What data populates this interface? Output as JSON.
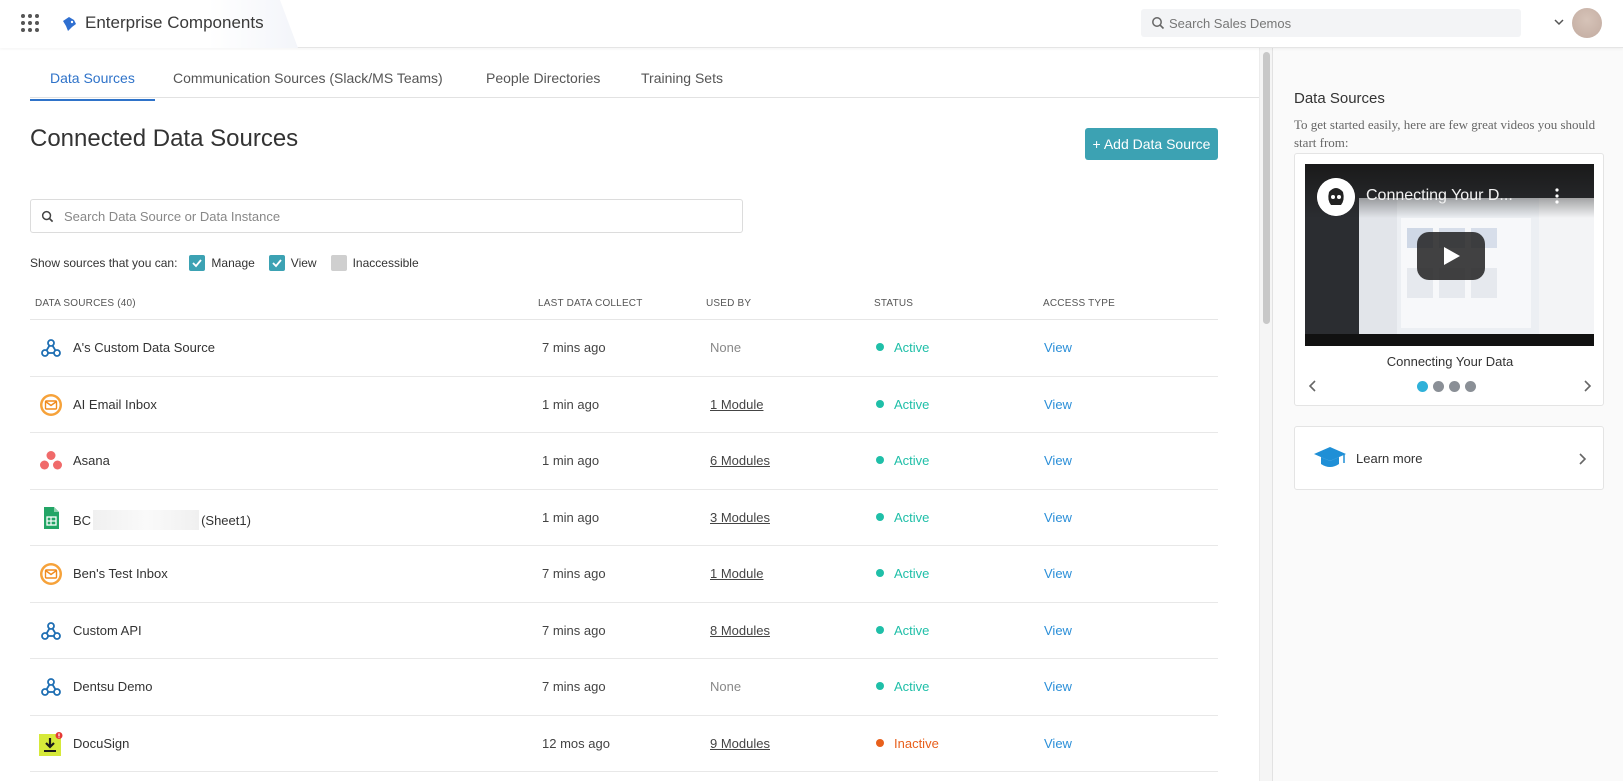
{
  "header": {
    "brand_title": "Enterprise Components",
    "search_placeholder": "Search Sales Demos"
  },
  "tabs": [
    {
      "label": "Data Sources",
      "active": true
    },
    {
      "label": "Communication Sources (Slack/MS Teams)",
      "active": false
    },
    {
      "label": "People Directories",
      "active": false
    },
    {
      "label": "Training Sets",
      "active": false
    }
  ],
  "page": {
    "title": "Connected Data Sources",
    "add_button": "+ Add Data Source",
    "search_placeholder": "Search Data Source or Data Instance"
  },
  "filters": {
    "label": "Show sources that you can:",
    "options": [
      {
        "label": "Manage",
        "checked": true
      },
      {
        "label": "View",
        "checked": true
      },
      {
        "label": "Inaccessible",
        "checked": false
      }
    ]
  },
  "table": {
    "headers": {
      "name": "DATA SOURCES (40)",
      "last_collect": "LAST DATA COLLECT",
      "used_by": "USED BY",
      "status": "STATUS",
      "access": "ACCESS TYPE"
    },
    "rows": [
      {
        "icon": "webhook-icon",
        "name": "A's Custom Data Source",
        "last_collect": "7 mins ago",
        "used_by": "None",
        "status": "Active",
        "access": "View"
      },
      {
        "icon": "email-inbox-icon",
        "name": "AI Email Inbox",
        "last_collect": "1 min ago",
        "used_by": "1 Module",
        "status": "Active",
        "access": "View"
      },
      {
        "icon": "asana-icon",
        "name": "Asana",
        "last_collect": "1 min ago",
        "used_by": "6 Modules",
        "status": "Active",
        "access": "View"
      },
      {
        "icon": "google-sheets-icon",
        "name": "BC",
        "name_suffix": "(Sheet1)",
        "last_collect": "1 min ago",
        "used_by": "3 Modules",
        "status": "Active",
        "access": "View"
      },
      {
        "icon": "email-inbox-icon",
        "name": "Ben's Test Inbox",
        "last_collect": "7 mins ago",
        "used_by": "1 Module",
        "status": "Active",
        "access": "View"
      },
      {
        "icon": "webhook-icon",
        "name": "Custom API",
        "last_collect": "7 mins ago",
        "used_by": "8 Modules",
        "status": "Active",
        "access": "View"
      },
      {
        "icon": "webhook-icon",
        "name": "Dentsu Demo",
        "last_collect": "7 mins ago",
        "used_by": "None",
        "status": "Active",
        "access": "View"
      },
      {
        "icon": "docusign-icon",
        "name": "DocuSign",
        "last_collect": "12 mos ago",
        "used_by": "9 Modules",
        "status": "Inactive",
        "access": "View"
      }
    ]
  },
  "side": {
    "title": "Data Sources",
    "description": "To get started easily, here are few great videos you should start from:",
    "video_title": "Connecting Your D...",
    "caption": "Connecting Your Data",
    "carousel_count": 4,
    "carousel_active": 0,
    "learn_more": "Learn more"
  },
  "colors": {
    "accent": "#2f73c9",
    "button": "#3ca2b3",
    "active_status": "#1fbfa8",
    "inactive_status": "#e8601c",
    "link": "#2b8fd8"
  }
}
